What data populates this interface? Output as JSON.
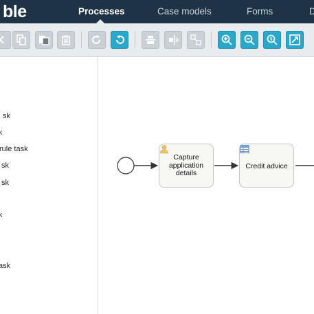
{
  "app": {
    "logo_text": "ble"
  },
  "nav": {
    "items": [
      {
        "label": "Processes",
        "active": true
      },
      {
        "label": "Case models",
        "active": false
      },
      {
        "label": "Forms",
        "active": false
      },
      {
        "label": "D",
        "active": false
      }
    ]
  },
  "toolbar": {
    "buttons": [
      {
        "icon": "chevron-left-icon",
        "style": "grey"
      },
      {
        "icon": "copy-icon",
        "style": "grey"
      },
      {
        "icon": "paste-icon",
        "style": "grey"
      },
      {
        "icon": "delete-icon",
        "style": "grey"
      },
      {
        "icon": "redo-icon",
        "style": "grey"
      },
      {
        "icon": "undo-icon",
        "style": "blue"
      },
      {
        "icon": "align-horizontal-icon",
        "style": "grey"
      },
      {
        "icon": "align-vertical-icon",
        "style": "grey"
      },
      {
        "icon": "same-size-icon",
        "style": "grey"
      },
      {
        "icon": "zoom-in-icon",
        "style": "blue"
      },
      {
        "icon": "zoom-out-icon",
        "style": "blue"
      },
      {
        "icon": "zoom-actual-icon",
        "style": "blue"
      },
      {
        "icon": "zoom-fit-icon",
        "style": "blue"
      }
    ]
  },
  "palette": {
    "items": [
      {
        "label": "sk"
      },
      {
        "label": "k"
      },
      {
        "label": "rule task"
      },
      {
        "label": "sk"
      },
      {
        "label": "sk"
      },
      {
        "label": "k"
      },
      {
        "label": "ask"
      }
    ]
  },
  "canvas": {
    "tasks": [
      {
        "label": "Capture application details",
        "icon": "user-icon"
      },
      {
        "label": "Credit advice",
        "icon": "table-icon"
      }
    ]
  },
  "colors": {
    "nav_bg": "#1f3346",
    "toolbar_bg": "#e8ecef",
    "button_blue": "#2aa7c9",
    "button_grey": "#c9d1d7",
    "task_fill": "#f7f7f4"
  }
}
